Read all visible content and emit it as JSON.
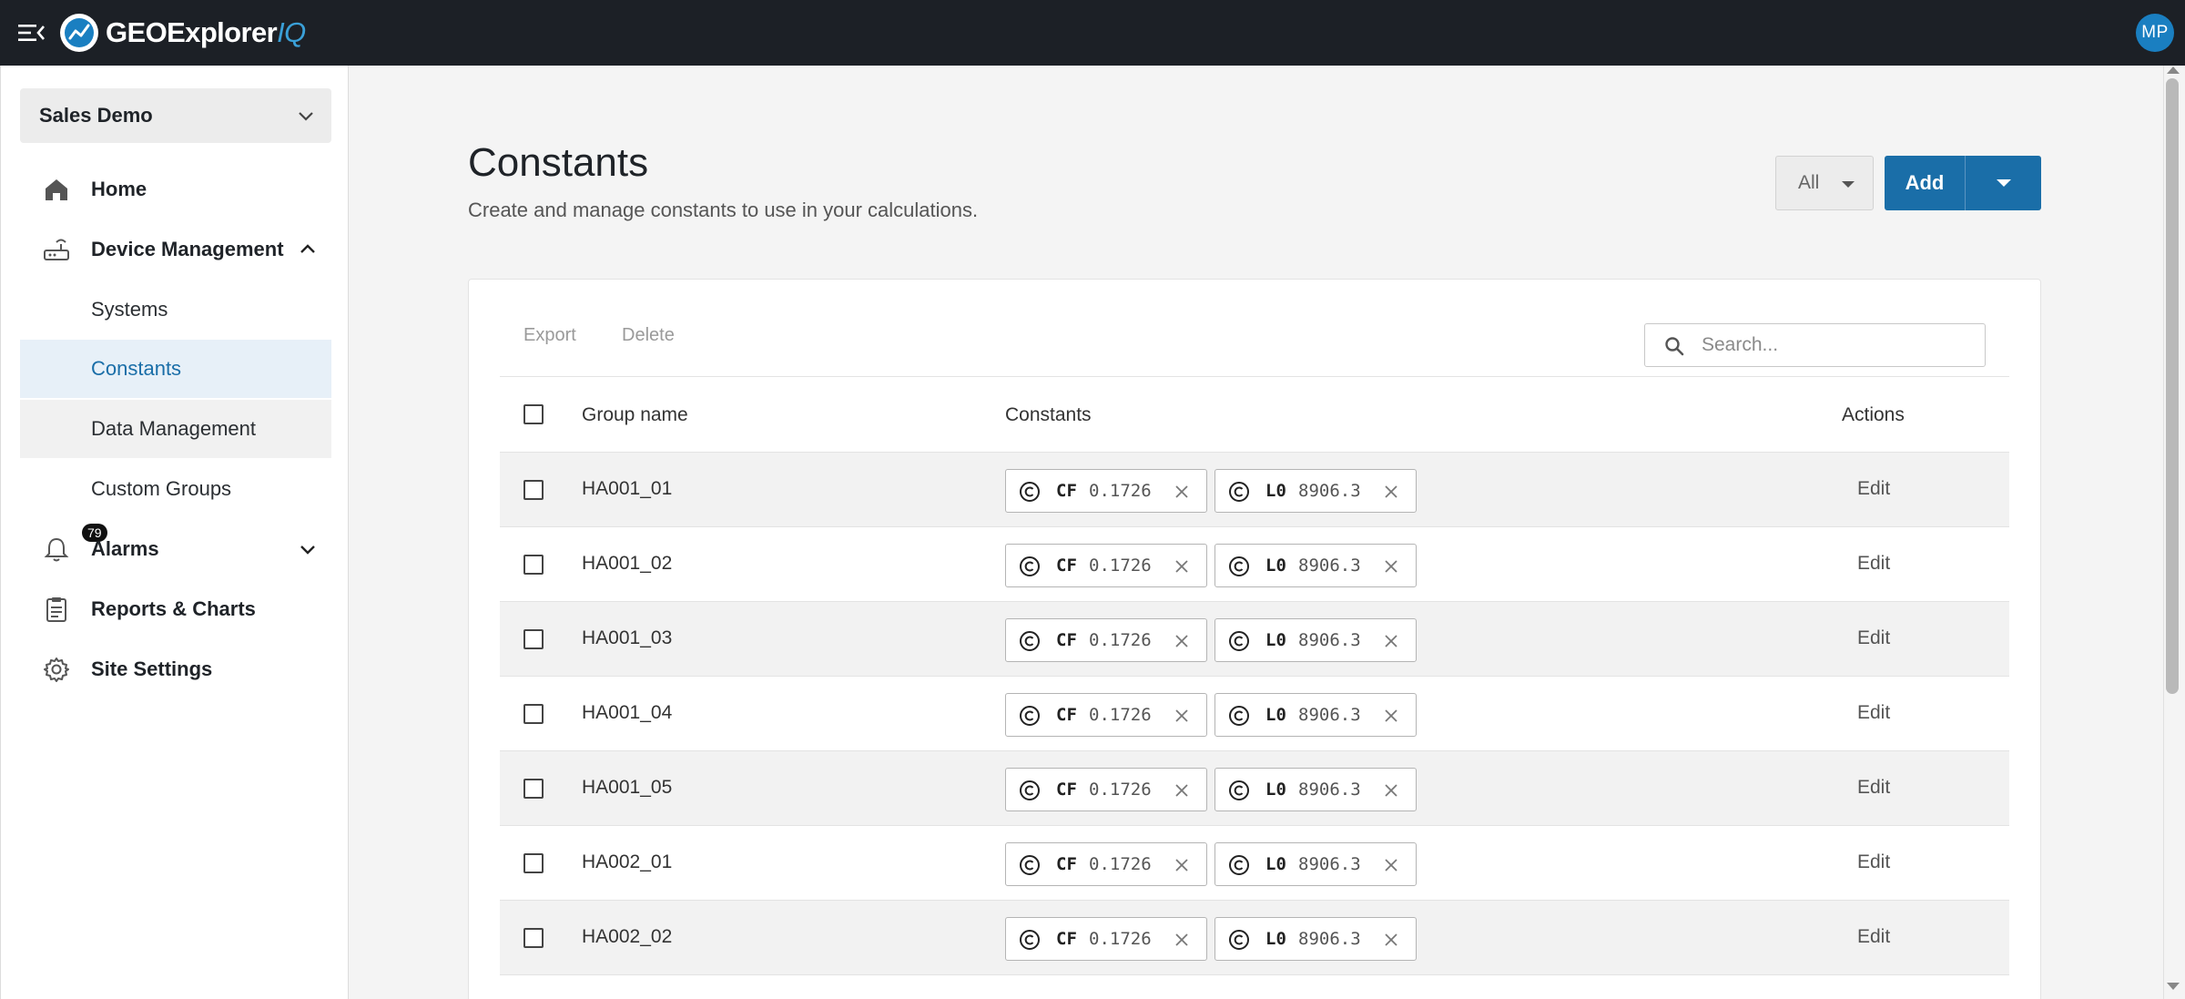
{
  "app": {
    "name_main": "GEOExplorer",
    "name_suffix": "IQ",
    "user_initials": "MP"
  },
  "sidebar": {
    "site": "Sales Demo",
    "items": [
      {
        "label": "Home",
        "icon": "home-icon"
      },
      {
        "label": "Device Management",
        "icon": "router-icon",
        "expanded": true
      },
      {
        "label": "Alarms",
        "icon": "bell-icon",
        "badge": "79"
      },
      {
        "label": "Reports & Charts",
        "icon": "clipboard-icon"
      },
      {
        "label": "Site Settings",
        "icon": "gear-icon"
      }
    ],
    "sub_items": [
      "Systems",
      "Constants",
      "Data Management",
      "Custom Groups"
    ],
    "active_sub": "Constants"
  },
  "page": {
    "title": "Constants",
    "subtitle": "Create and manage constants to use in your calculations.",
    "filter_value": "All",
    "add_label": "Add"
  },
  "toolbar": {
    "export_label": "Export",
    "delete_label": "Delete",
    "search_placeholder": "Search..."
  },
  "table": {
    "columns": [
      "Group name",
      "Constants",
      "Actions"
    ],
    "action_label": "Edit",
    "rows": [
      {
        "name": "HA001_01",
        "constants": [
          {
            "key": "CF",
            "value": "0.1726"
          },
          {
            "key": "L0",
            "value": "8906.3"
          }
        ]
      },
      {
        "name": "HA001_02",
        "constants": [
          {
            "key": "CF",
            "value": "0.1726"
          },
          {
            "key": "L0",
            "value": "8906.3"
          }
        ]
      },
      {
        "name": "HA001_03",
        "constants": [
          {
            "key": "CF",
            "value": "0.1726"
          },
          {
            "key": "L0",
            "value": "8906.3"
          }
        ]
      },
      {
        "name": "HA001_04",
        "constants": [
          {
            "key": "CF",
            "value": "0.1726"
          },
          {
            "key": "L0",
            "value": "8906.3"
          }
        ]
      },
      {
        "name": "HA001_05",
        "constants": [
          {
            "key": "CF",
            "value": "0.1726"
          },
          {
            "key": "L0",
            "value": "8906.3"
          }
        ]
      },
      {
        "name": "HA002_01",
        "constants": [
          {
            "key": "CF",
            "value": "0.1726"
          },
          {
            "key": "L0",
            "value": "8906.3"
          }
        ]
      },
      {
        "name": "HA002_02",
        "constants": [
          {
            "key": "CF",
            "value": "0.1726"
          },
          {
            "key": "L0",
            "value": "8906.3"
          }
        ]
      }
    ]
  },
  "colors": {
    "topbar": "#1c2026",
    "accent": "#1a6ea8",
    "active_bg": "#e7f0f8"
  }
}
